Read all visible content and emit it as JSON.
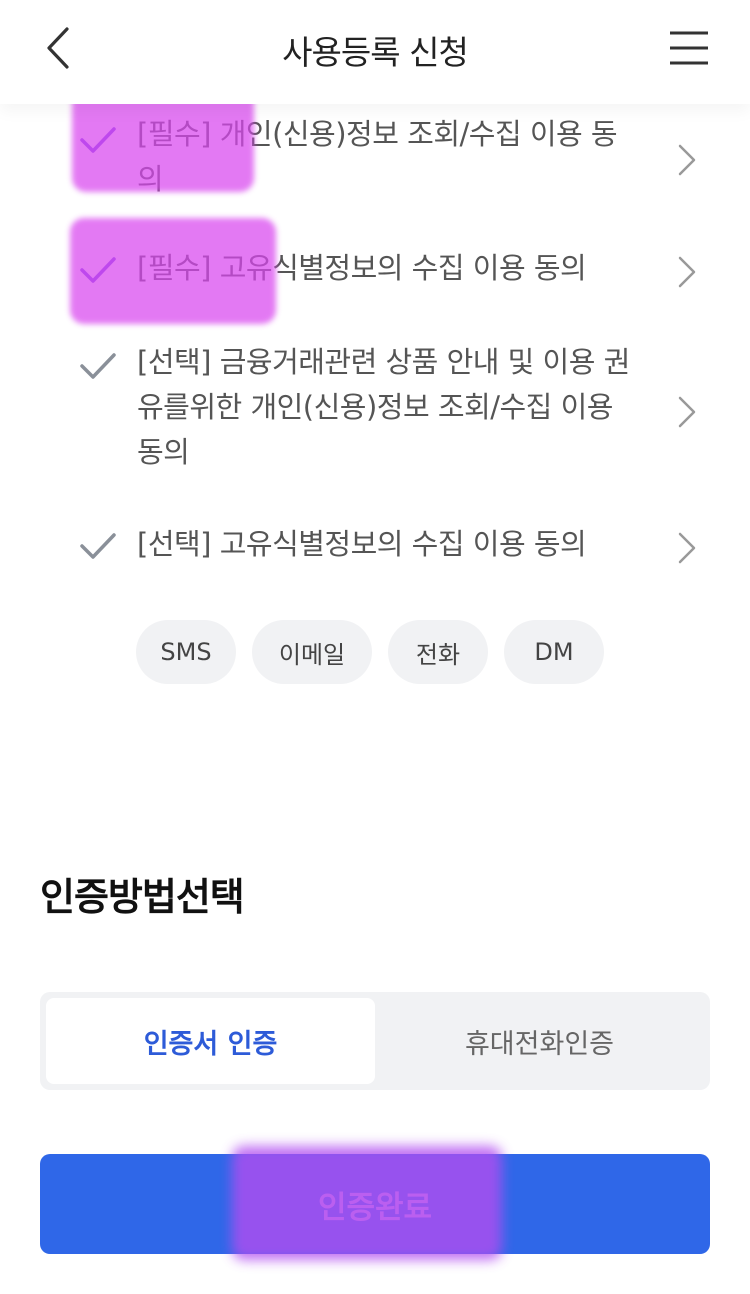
{
  "header": {
    "title": "사용등록 신청",
    "back_icon": "chevron-left-icon",
    "menu_icon": "hamburger-menu-icon"
  },
  "consents": [
    {
      "label": "[필수] 개인(신용)정보 조회/수집 이용 동의",
      "checked": true
    },
    {
      "label": "[필수] 고유식별정보의 수집 이용 동의",
      "checked": true
    },
    {
      "label": "[선택] 금융거래관련 상품 안내 및 이용 권유를위한 개인(신용)정보 조회/수집 이용 동의",
      "checked": false
    },
    {
      "label": "[선택] 고유식별정보의 수집 이용 동의",
      "checked": false
    }
  ],
  "contact_channels": [
    "SMS",
    "이메일",
    "전화",
    "DM"
  ],
  "auth": {
    "section_title": "인증방법선택",
    "options": [
      "인증서 인증",
      "휴대전화인증"
    ],
    "selected": "인증서 인증"
  },
  "submit_label": "인증완료",
  "colors": {
    "accent": "#2f67e8",
    "selected_text": "#2d5bd8",
    "check_gray": "#8a9099",
    "highlight": "#d946ef"
  }
}
